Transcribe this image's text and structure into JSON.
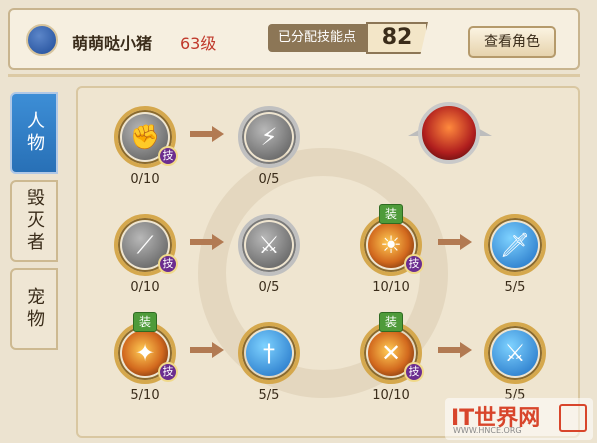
{
  "header": {
    "player_name": "萌萌哒小猪",
    "player_level": "63级",
    "points_label": "已分配技能点",
    "points_value": "82",
    "view_button": "查看角色"
  },
  "tabs": [
    {
      "label": "人物",
      "active": true
    },
    {
      "label": "毁灭者",
      "active": false
    },
    {
      "label": "宠物",
      "active": false
    }
  ],
  "skills": {
    "r1c1": {
      "level": "0/10",
      "tag": "技"
    },
    "r1c2": {
      "level": "0/5"
    },
    "r2c1": {
      "level": "0/10",
      "tag": "技"
    },
    "r2c2": {
      "level": "0/5"
    },
    "r2c3": {
      "level": "10/10",
      "tag": "技",
      "equip": "装"
    },
    "r2c4": {
      "level": "5/5"
    },
    "r3c1": {
      "level": "5/10",
      "tag": "技",
      "equip": "装"
    },
    "r3c2": {
      "level": "5/5"
    },
    "r3c3": {
      "level": "10/10",
      "tag": "技",
      "equip": "装"
    },
    "r3c4": {
      "level": "5/5"
    }
  },
  "watermark": {
    "main": "IT世界网",
    "sub": "WWW.HNCE.ORG"
  },
  "colors": {
    "accent_blue": "#2870b6",
    "level_red": "#c0392b",
    "gold_ring": "#d5a84d"
  }
}
